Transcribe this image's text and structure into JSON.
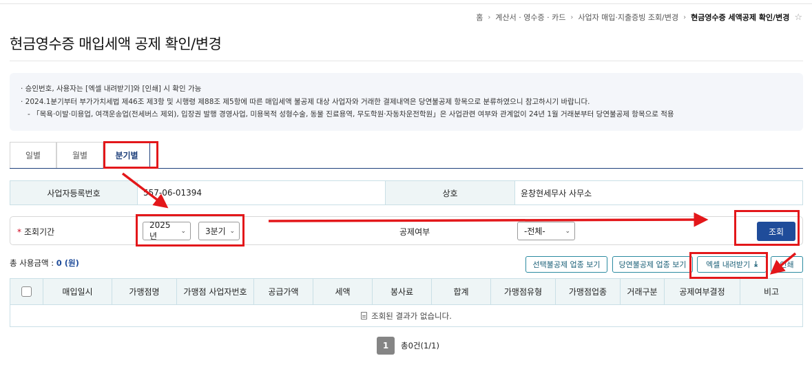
{
  "breadcrumb": [
    "홈",
    "계산서 · 영수증 · 카드",
    "사업자 매입·지출증빙 조회/변경",
    "현금영수증 세액공제 확인/변경"
  ],
  "page_title": "현금영수증 매입세액 공제 확인/변경",
  "notice": [
    "· 승인번호, 사용자는 [엑셀 내려받기]와 [인쇄] 시 확인 가능",
    "· 2024.1분기부터 부가가치세법 제46조 제3항 및 시행령 제88조 제5항에 따른 매입세액 불공제 대상 사업자와 거래한 결제내역은 당연불공제 항목으로 분류하였으니 참고하시기 바랍니다.",
    "- 「목욕·이발·미용업, 여객운송업(전세버스 제외), 입장권 발행 경영사업, 미용목적 성형수술, 동물 진료용역, 무도학원·자동차운전학원」은 사업관련 여부와 관계없이 24년 1월 거래분부터 당연불공제 항목으로 적용"
  ],
  "tabs": [
    "일별",
    "월별",
    "분기별"
  ],
  "active_tab": "분기별",
  "info": {
    "biz_no_label": "사업자등록번호",
    "biz_no": "557-06-01394",
    "company_label": "상호",
    "company": "윤창현세무사 사무소"
  },
  "search": {
    "period_label": "조회기간",
    "year": "2025년",
    "quarter": "3분기",
    "deduct_label": "공제여부",
    "deduct_value": "-전체-",
    "search_button": "조회"
  },
  "total": {
    "label": "총 사용금액 : ",
    "amount": "0 (원)"
  },
  "buttons": {
    "selected_nondeduct": "선택불공제 업종 보기",
    "auto_nondeduct": "당연불공제 업종 보기",
    "excel": "엑셀 내려받기",
    "print": "인쇄"
  },
  "table": {
    "columns": [
      "매입일시",
      "가맹점명",
      "가맹점 사업자번호",
      "공급가액",
      "세액",
      "봉사료",
      "합계",
      "가맹점유형",
      "가맹점업종",
      "거래구분",
      "공제여부결정",
      "비고"
    ],
    "empty_message": "조회된 결과가 없습니다."
  },
  "pager": {
    "page": "1",
    "count": "총0건(1/1)"
  },
  "colors": {
    "accent": "#1f4c9a",
    "highlight": "#e3171a",
    "teal": "#2a8aa0"
  }
}
